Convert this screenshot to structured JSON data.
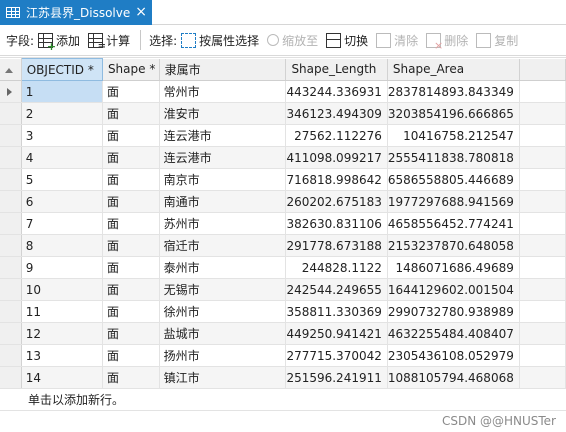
{
  "tab": {
    "title": "江苏县界_Dissolve",
    "close_glyph": "×"
  },
  "toolbar": {
    "fields_label": "字段:",
    "add_label": "添加",
    "calculate_label": "计算",
    "selection_label": "选择:",
    "select_by_attr_label": "按属性选择",
    "zoom_to_label": "缩放至",
    "switch_label": "切换",
    "clear_label": "清除",
    "delete_label": "删除",
    "copy_label": "复制"
  },
  "table": {
    "columns": [
      "OBJECTID *",
      "Shape *",
      "隶属市",
      "Shape_Length",
      "Shape_Area"
    ],
    "rows": [
      {
        "objectid": "1",
        "shape": "面",
        "city": "常州市",
        "length": "443244.336931",
        "area": "2837814893.843349"
      },
      {
        "objectid": "2",
        "shape": "面",
        "city": "淮安市",
        "length": "346123.494309",
        "area": "3203854196.666865"
      },
      {
        "objectid": "3",
        "shape": "面",
        "city": "连云港市",
        "length": "27562.112276",
        "area": "10416758.212547"
      },
      {
        "objectid": "4",
        "shape": "面",
        "city": "连云港市",
        "length": "411098.099217",
        "area": "2555411838.780818"
      },
      {
        "objectid": "5",
        "shape": "面",
        "city": "南京市",
        "length": "716818.998642",
        "area": "6586558805.446689"
      },
      {
        "objectid": "6",
        "shape": "面",
        "city": "南通市",
        "length": "260202.675183",
        "area": "1977297688.941569"
      },
      {
        "objectid": "7",
        "shape": "面",
        "city": "苏州市",
        "length": "382630.831106",
        "area": "4658556452.774241"
      },
      {
        "objectid": "8",
        "shape": "面",
        "city": "宿迁市",
        "length": "291778.673188",
        "area": "2153237870.648058"
      },
      {
        "objectid": "9",
        "shape": "面",
        "city": "泰州市",
        "length": "244828.1122",
        "area": "1486071686.49689"
      },
      {
        "objectid": "10",
        "shape": "面",
        "city": "无锡市",
        "length": "242544.249655",
        "area": "1644129602.001504"
      },
      {
        "objectid": "11",
        "shape": "面",
        "city": "徐州市",
        "length": "358811.330369",
        "area": "2990732780.938989"
      },
      {
        "objectid": "12",
        "shape": "面",
        "city": "盐城市",
        "length": "449250.941421",
        "area": "4632255484.408407"
      },
      {
        "objectid": "13",
        "shape": "面",
        "city": "扬州市",
        "length": "277715.370042",
        "area": "2305436108.052979"
      },
      {
        "objectid": "14",
        "shape": "面",
        "city": "镇江市",
        "length": "251596.241911",
        "area": "1088105794.468068"
      }
    ],
    "add_row_text": "单击以添加新行。"
  },
  "watermark": "CSDN @@HNUSTer",
  "colors": {
    "tab_accent": "#1f7dc5",
    "selected_cell": "#c6def4"
  }
}
